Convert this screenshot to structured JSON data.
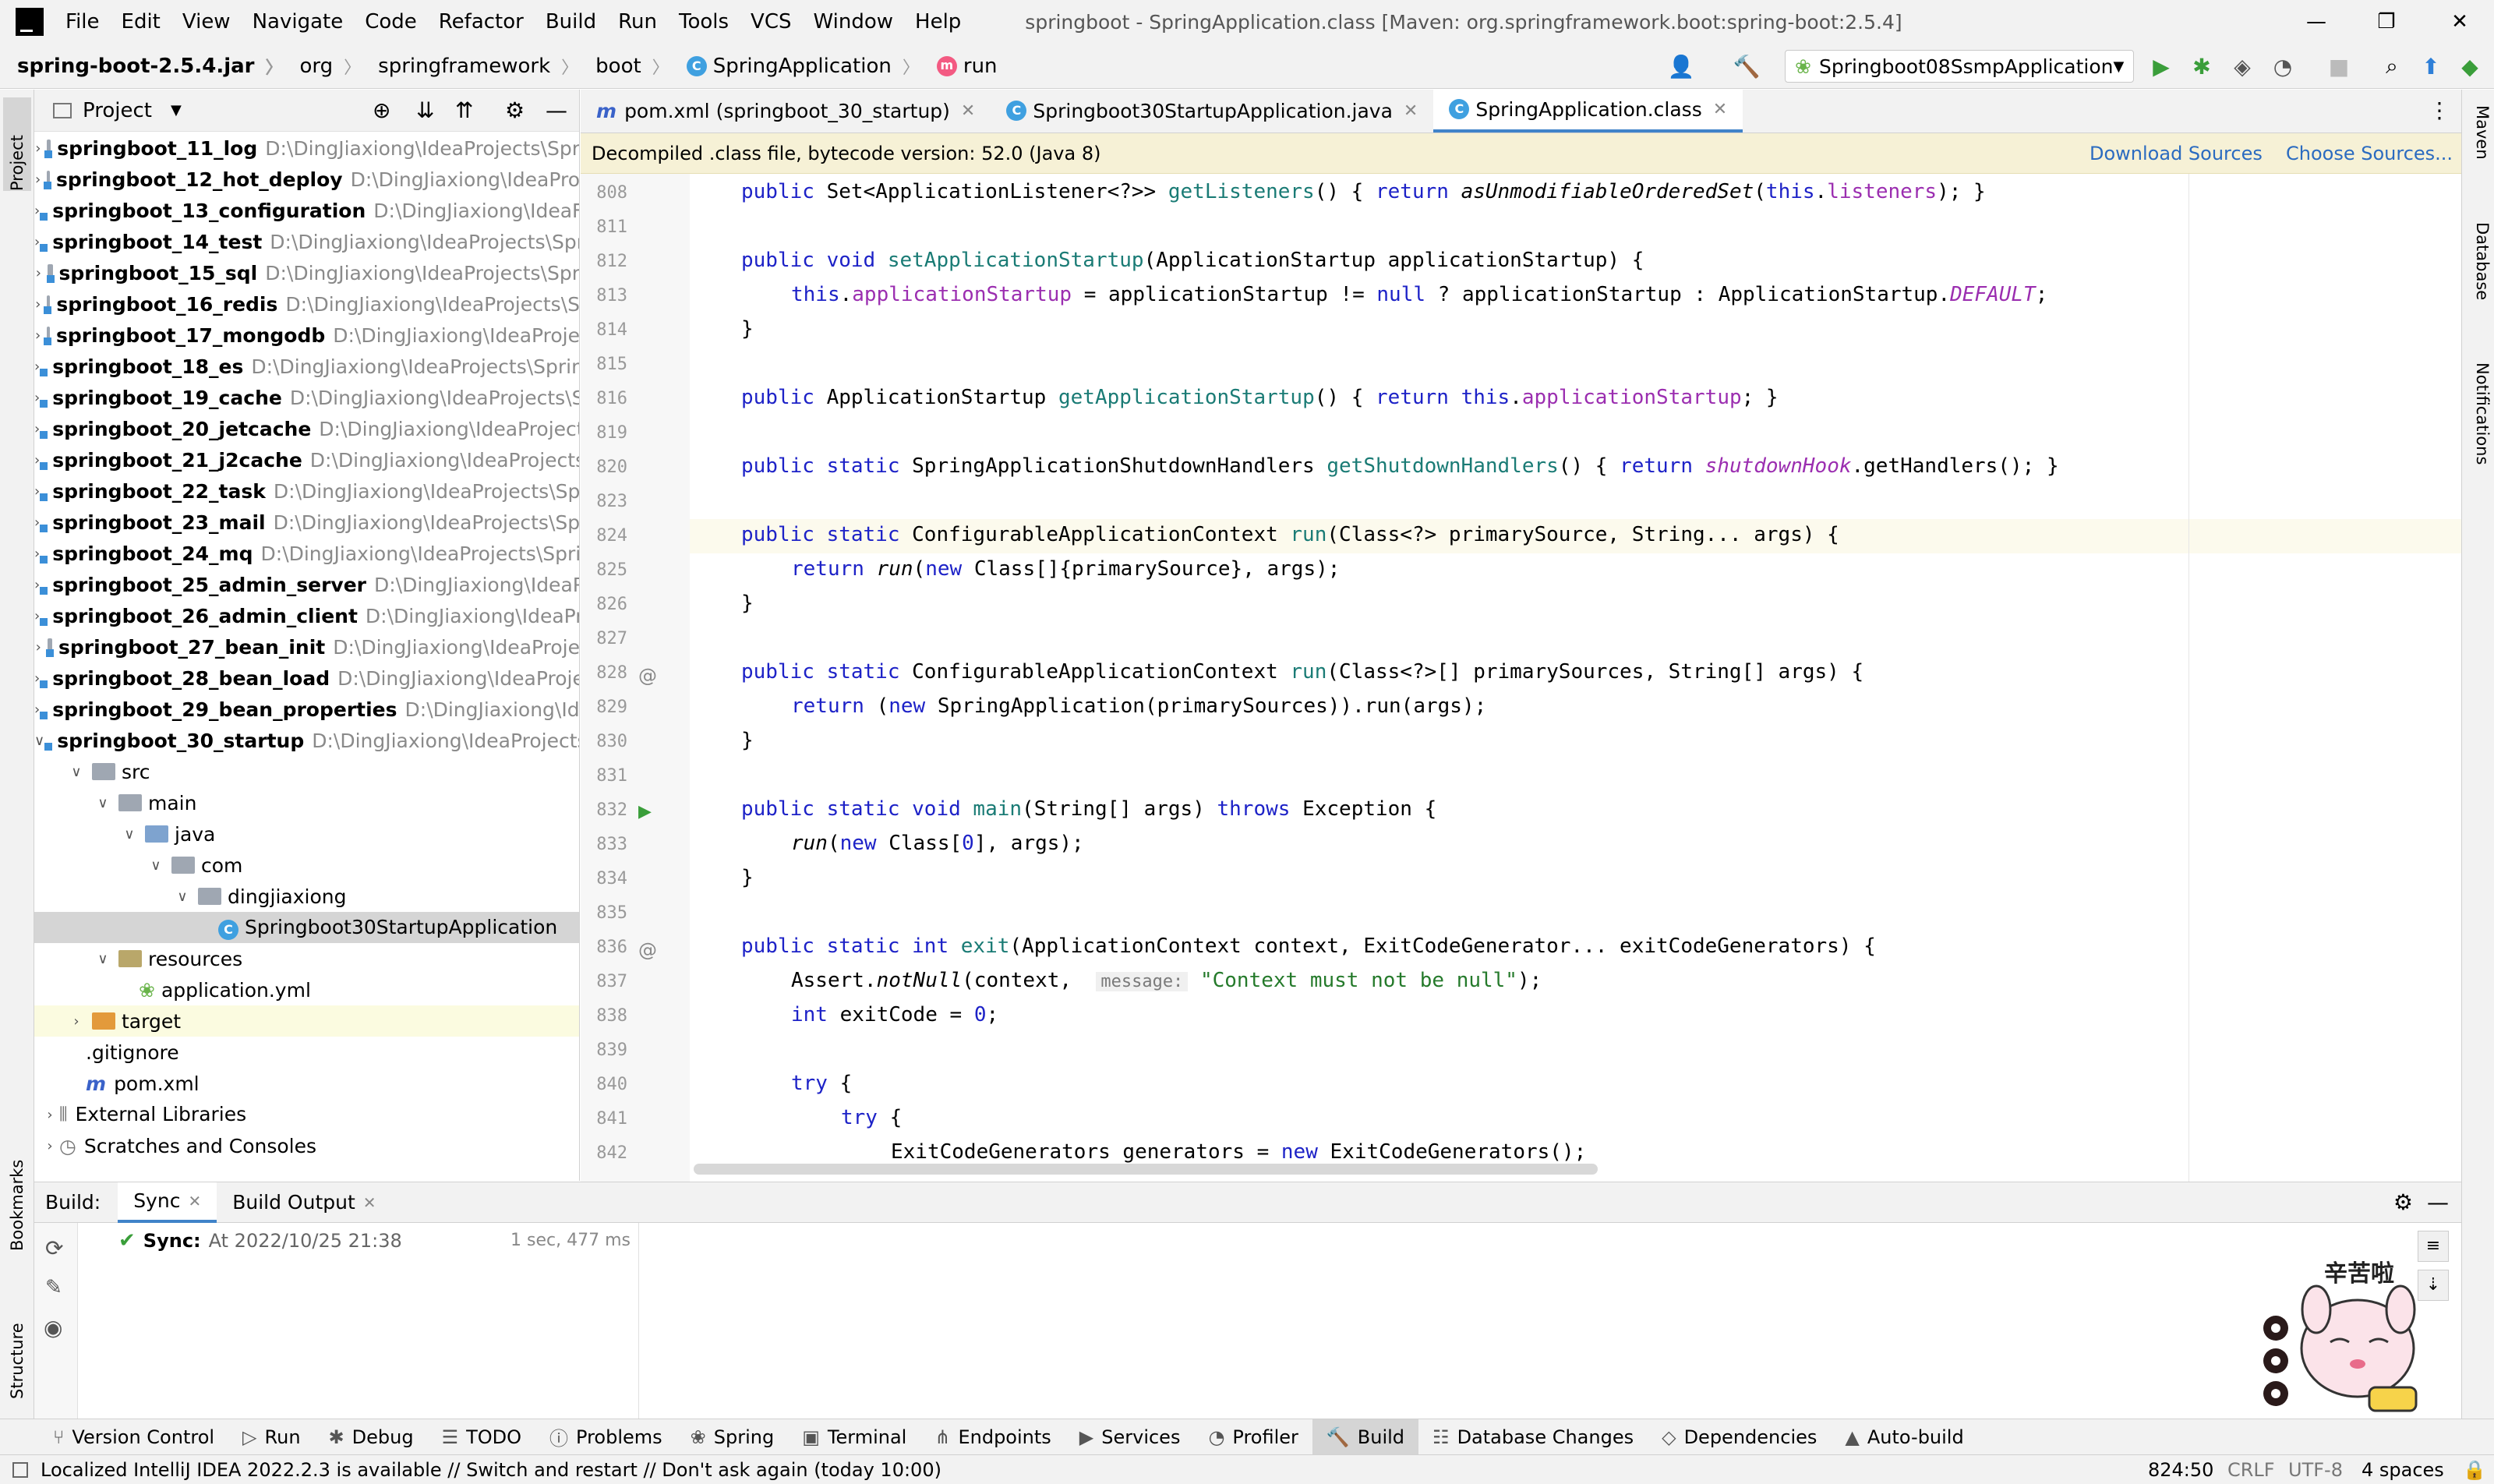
{
  "menu": [
    "File",
    "Edit",
    "View",
    "Navigate",
    "Code",
    "Refactor",
    "Build",
    "Run",
    "Tools",
    "VCS",
    "Window",
    "Help"
  ],
  "window_title": "springboot - SpringApplication.class [Maven: org.springframework.boot:spring-boot:2.5.4]",
  "breadcrumbs": [
    "spring-boot-2.5.4.jar",
    "org",
    "springframework",
    "boot",
    "SpringApplication",
    "run"
  ],
  "run_config": "Springboot08SsmpApplication",
  "project_panel": {
    "title": "Project",
    "rows": [
      {
        "name": "springboot_11_log",
        "path": "D:\\DingJiaxiong\\IdeaProjects\\Spr"
      },
      {
        "name": "springboot_12_hot_deploy",
        "path": "D:\\DingJiaxiong\\IdeaPro"
      },
      {
        "name": "springboot_13_configuration",
        "path": "D:\\DingJiaxiong\\IdeaF"
      },
      {
        "name": "springboot_14_test",
        "path": "D:\\DingJiaxiong\\IdeaProjects\\Spr"
      },
      {
        "name": "springboot_15_sql",
        "path": "D:\\DingJiaxiong\\IdeaProjects\\Spr"
      },
      {
        "name": "springboot_16_redis",
        "path": "D:\\DingJiaxiong\\IdeaProjects\\S"
      },
      {
        "name": "springboot_17_mongodb",
        "path": "D:\\DingJiaxiong\\IdeaProje"
      },
      {
        "name": "springboot_18_es",
        "path": "D:\\DingJiaxiong\\IdeaProjects\\Sprin"
      },
      {
        "name": "springboot_19_cache",
        "path": "D:\\DingJiaxiong\\IdeaProjects\\S"
      },
      {
        "name": "springboot_20_jetcache",
        "path": "D:\\DingJiaxiong\\IdeaProject"
      },
      {
        "name": "springboot_21_j2cache",
        "path": "D:\\DingJiaxiong\\IdeaProjects"
      },
      {
        "name": "springboot_22_task",
        "path": "D:\\DingJiaxiong\\IdeaProjects\\Sp"
      },
      {
        "name": "springboot_23_mail",
        "path": "D:\\DingJiaxiong\\IdeaProjects\\Sp"
      },
      {
        "name": "springboot_24_mq",
        "path": "D:\\DingJiaxiong\\IdeaProjects\\Spri"
      },
      {
        "name": "springboot_25_admin_server",
        "path": "D:\\DingJiaxiong\\IdeaP"
      },
      {
        "name": "springboot_26_admin_client",
        "path": "D:\\DingJiaxiong\\IdeaPr"
      },
      {
        "name": "springboot_27_bean_init",
        "path": "D:\\DingJiaxiong\\IdeaProje"
      },
      {
        "name": "springboot_28_bean_load",
        "path": "D:\\DingJiaxiong\\IdeaProje"
      },
      {
        "name": "springboot_29_bean_properties",
        "path": "D:\\DingJiaxiong\\Ide"
      },
      {
        "name": "springboot_30_startup",
        "path": "D:\\DingJiaxiong\\IdeaProjects"
      }
    ],
    "sub": {
      "src": "src",
      "main": "main",
      "java": "java",
      "com": "com",
      "pkg": "dingjiaxiong",
      "app": "Springboot30StartupApplication",
      "resources": "resources",
      "yml": "application.yml",
      "target": "target",
      "gitignore": ".gitignore",
      "pom": "pom.xml",
      "ext": "External Libraries",
      "scratch": "Scratches and Consoles"
    }
  },
  "tabs": [
    {
      "label": "pom.xml (springboot_30_startup)"
    },
    {
      "label": "Springboot30StartupApplication.java"
    },
    {
      "label": "SpringApplication.class"
    }
  ],
  "banner": {
    "text": "Decompiled .class file, bytecode version: 52.0 (Java 8)",
    "download": "Download Sources",
    "choose": "Choose Sources..."
  },
  "line_numbers": [
    "808",
    "811",
    "812",
    "813",
    "814",
    "815",
    "816",
    "819",
    "820",
    "823",
    "824",
    "825",
    "826",
    "827",
    "828",
    "829",
    "830",
    "831",
    "832",
    "833",
    "834",
    "835",
    "836",
    "837",
    "838",
    "839",
    "840",
    "841",
    "842"
  ],
  "code": {
    "l808": "public Set<ApplicationListener<?>> getListeners() { return asUnmodifiableOrderedSet(this.listeners); }",
    "l812": "public void setApplicationStartup(ApplicationStartup applicationStartup) {",
    "l813": "    this.applicationStartup = applicationStartup != null ? applicationStartup : ApplicationStartup.DEFAULT;",
    "l816": "public ApplicationStartup getApplicationStartup() { return this.applicationStartup; }",
    "l820": "public static SpringApplicationShutdownHandlers getShutdownHandlers() { return shutdownHook.getHandlers(); }",
    "l824": "public static ConfigurableApplicationContext run(Class<?> primarySource, String... args) {",
    "l825": "    return run(new Class[]{primarySource}, args);",
    "l828": "public static ConfigurableApplicationContext run(Class<?>[] primarySources, String[] args) {",
    "l829": "    return (new SpringApplication(primarySources)).run(args);",
    "l832": "public static void main(String[] args) throws Exception {",
    "l833": "    run(new Class[0], args);",
    "l836": "public static int exit(ApplicationContext context, ExitCodeGenerator... exitCodeGenerators) {",
    "l837_a": "    Assert.notNull(context, ",
    "l837_hint": "message:",
    "l837_b": " \"Context must not be null\");",
    "l838": "    int exitCode = 0;",
    "l840": "    try {",
    "l841": "        try {",
    "l842": "            ExitCodeGenerators generators = new ExitCodeGenerators();",
    "close": "}"
  },
  "build": {
    "label": "Build:",
    "tab_sync": "Sync",
    "tab_output": "Build Output",
    "sync_title": "Sync:",
    "sync_time": "At 2022/10/25 21:38",
    "duration": "1 sec, 477 ms"
  },
  "tool_windows": [
    "Version Control",
    "Run",
    "Debug",
    "TODO",
    "Problems",
    "Spring",
    "Terminal",
    "Endpoints",
    "Services",
    "Profiler",
    "Build",
    "Database Changes",
    "Dependencies",
    "Auto-build"
  ],
  "status": {
    "message": "Localized IntelliJ IDEA 2022.2.3 is available // Switch and restart // Don't ask again (today 10:00)",
    "position": "824:50",
    "line_sep": "CRLF",
    "encoding": "UTF-8",
    "indent": "4 spaces"
  },
  "side_tabs": {
    "project": "Project",
    "bookmarks": "Bookmarks",
    "structure": "Structure",
    "maven": "Maven",
    "database": "Database",
    "notifications": "Notifications"
  },
  "sticker_text": "辛苦啦"
}
